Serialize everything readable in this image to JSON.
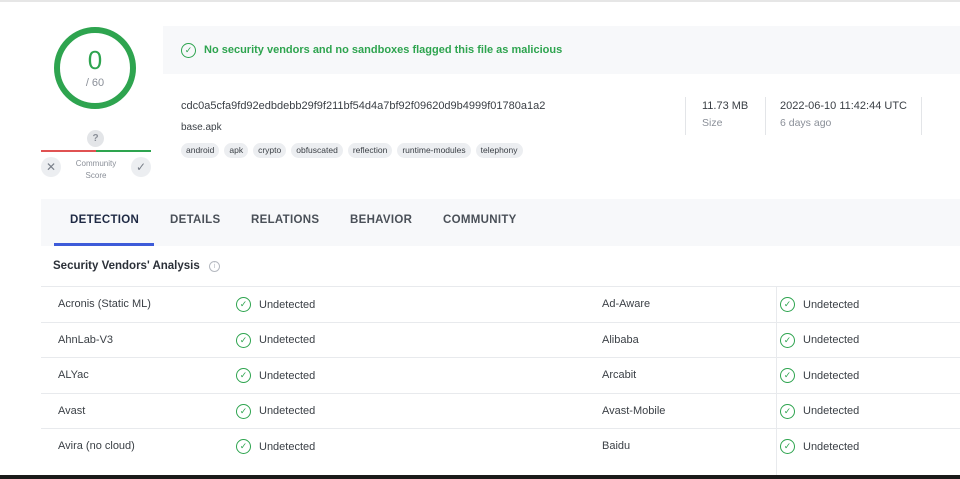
{
  "score": {
    "detections": "0",
    "total": "/ 60"
  },
  "community": {
    "label_line1": "Community",
    "label_line2": "Score",
    "question": "?"
  },
  "banner": {
    "text": "No security vendors and no sandboxes flagged this file as malicious"
  },
  "file": {
    "hash": "cdc0a5cfa9fd92edbdebb29f9f211bf54d4a7bf92f09620d9b4999f01780a1a2",
    "name": "base.apk",
    "tags": [
      "android",
      "apk",
      "crypto",
      "obfuscated",
      "reflection",
      "runtime-modules",
      "telephony"
    ],
    "size_value": "11.73 MB",
    "size_label": "Size",
    "date_value": "2022-06-10 11:42:44 UTC",
    "date_label": "6 days ago"
  },
  "tabs": [
    "DETECTION",
    "DETAILS",
    "RELATIONS",
    "BEHAVIOR",
    "COMMUNITY"
  ],
  "section": {
    "title": "Security Vendors' Analysis"
  },
  "vendors": [
    {
      "left": "Acronis (Static ML)",
      "left_result": "Undetected",
      "right": "Ad-Aware",
      "right_result": "Undetected"
    },
    {
      "left": "AhnLab-V3",
      "left_result": "Undetected",
      "right": "Alibaba",
      "right_result": "Undetected"
    },
    {
      "left": "ALYac",
      "left_result": "Undetected",
      "right": "Arcabit",
      "right_result": "Undetected"
    },
    {
      "left": "Avast",
      "left_result": "Undetected",
      "right": "Avast-Mobile",
      "right_result": "Undetected"
    },
    {
      "left": "Avira (no cloud)",
      "left_result": "Undetected",
      "right": "Baidu",
      "right_result": "Undetected"
    }
  ],
  "colors": {
    "accent_green": "#2ea44f",
    "tab_underline": "#3d5bd9",
    "negative": "#e05252"
  }
}
